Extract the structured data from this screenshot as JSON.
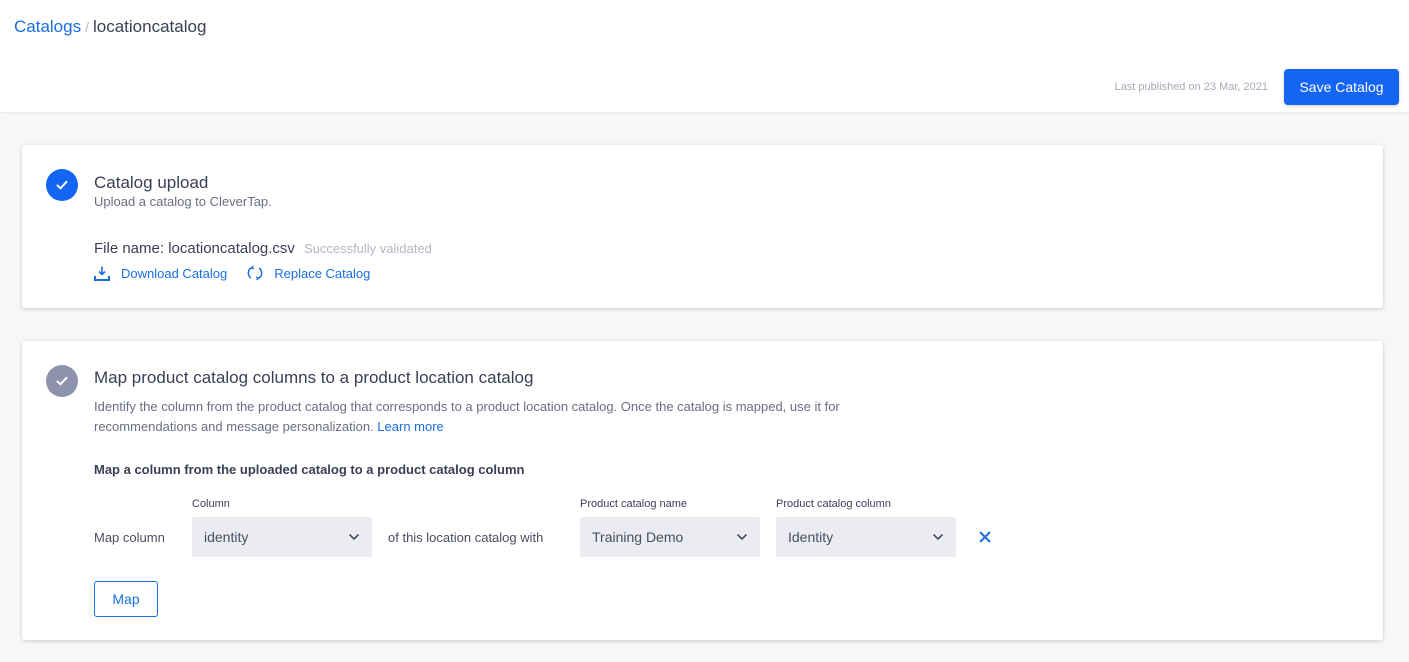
{
  "header": {
    "breadcrumb": {
      "parent": "Catalogs",
      "separator": "/",
      "current": "locationcatalog"
    },
    "last_published": "Last published on 23 Mar, 2021",
    "save_label": "Save Catalog"
  },
  "upload_card": {
    "title": "Catalog upload",
    "subtitle": "Upload a catalog to CleverTap.",
    "file_name": "File name: locationcatalog.csv",
    "file_status": "Successfully validated",
    "download_label": "Download Catalog",
    "replace_label": "Replace Catalog"
  },
  "map_card": {
    "title": "Map product catalog columns to a product location catalog",
    "description": "Identify the column from the product catalog that corresponds to a product location catalog. Once the catalog is mapped, use it for recommendations and message personalization.",
    "learn_more": "Learn more",
    "heading": "Map a column from the uploaded catalog to a product catalog column",
    "row": {
      "prefix": "Map column",
      "column_label": "Column",
      "column_value": "identity",
      "middle_text": "of this location catalog with",
      "catalog_name_label": "Product catalog name",
      "catalog_name_value": "Training Demo",
      "catalog_column_label": "Product catalog column",
      "catalog_column_value": "Identity"
    },
    "map_label": "Map"
  }
}
